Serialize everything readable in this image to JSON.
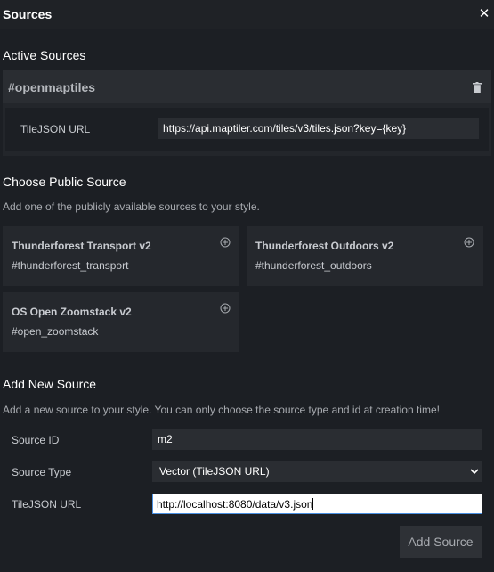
{
  "header": {
    "title": "Sources",
    "close_symbol": "✕"
  },
  "active": {
    "title": "Active Sources",
    "source": {
      "id": "#openmaptiles",
      "field_label": "TileJSON URL",
      "url": "https://api.maptiler.com/tiles/v3/tiles.json?key={key}"
    }
  },
  "public": {
    "title": "Choose Public Source",
    "description": "Add one of the publicly available sources to your style.",
    "cards": [
      {
        "title": "Thunderforest Transport v2",
        "id": "#thunderforest_transport"
      },
      {
        "title": "Thunderforest Outdoors v2",
        "id": "#thunderforest_outdoors"
      },
      {
        "title": "OS Open Zoomstack v2",
        "id": "#open_zoomstack"
      }
    ]
  },
  "add_new": {
    "title": "Add New Source",
    "description": "Add a new source to your style. You can only choose the source type and id at creation time!",
    "source_id_label": "Source ID",
    "source_id_value": "m2",
    "source_type_label": "Source Type",
    "source_type_value": "Vector (TileJSON URL)",
    "tilejson_label": "TileJSON URL",
    "tilejson_value": "http://localhost:8080/data/v3.json",
    "button_label": "Add Source"
  },
  "icons": {
    "close": "close-icon",
    "trash": "trash-icon",
    "add": "plus-circle-icon",
    "chevron": "chevron-down-icon"
  },
  "colors": {
    "background": "#1c1f24",
    "card": "#25282d",
    "input": "#2a2d32",
    "focus_border": "#4a90e2"
  }
}
